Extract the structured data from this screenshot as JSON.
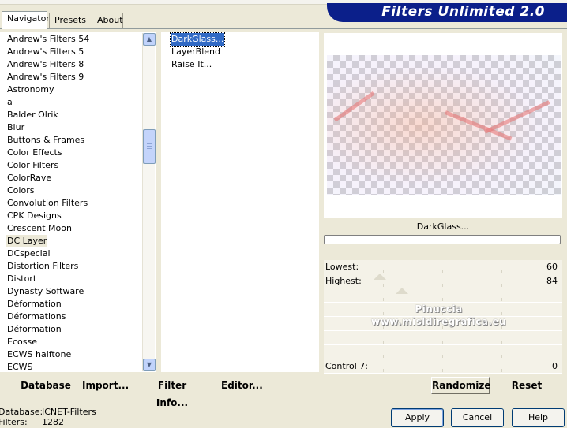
{
  "header": {
    "banner_title": "Filters Unlimited 2.0"
  },
  "tabs": [
    {
      "label": "Navigator",
      "active": true
    },
    {
      "label": "Presets",
      "active": false
    },
    {
      "label": "About",
      "active": false
    }
  ],
  "categories": {
    "items": [
      "Andrew's Filters 54",
      "Andrew's Filters 5",
      "Andrew's Filters 8",
      "Andrew's Filters 9",
      "Astronomy",
      "a",
      "Balder Olrik",
      "Blur",
      "Buttons & Frames",
      "Color Effects",
      "Color Filters",
      "ColorRave",
      "Colors",
      "Convolution Filters",
      "CPK Designs",
      "Crescent Moon",
      "DC Layer",
      "DCspecial",
      "Distortion Filters",
      "Distort",
      "Dynasty Software",
      "Déformation",
      "Déformations",
      "Déformation",
      "Ecosse",
      "ECWS halftone",
      "ECWS"
    ],
    "selected": "DC Layer"
  },
  "filters": {
    "items": [
      "DarkGlass...",
      "LayerBlend",
      "Raise It..."
    ],
    "selected": "DarkGlass..."
  },
  "preview": {
    "filter_name": "DarkGlass...",
    "watermark_line1": "Pinuccia",
    "watermark_line2": "www.misldiregrafica.eu"
  },
  "sliders": [
    {
      "label": "Lowest:",
      "value": "60"
    },
    {
      "label": "Highest:",
      "value": "84"
    },
    {
      "label": "",
      "value": ""
    },
    {
      "label": "",
      "value": ""
    },
    {
      "label": "",
      "value": ""
    },
    {
      "label": "",
      "value": ""
    },
    {
      "label": "",
      "value": ""
    },
    {
      "label": "Control 7:",
      "value": "0"
    }
  ],
  "toolbar": {
    "database": "Database",
    "import": "Import...",
    "filter_info": "Filter Info...",
    "editor": "Editor...",
    "randomize": "Randomize",
    "reset": "Reset"
  },
  "status": {
    "database_label": "Database:",
    "database_value": "ICNET-Filters",
    "filters_label": "Filters:",
    "filters_value": "1282"
  },
  "dialog": {
    "apply": "Apply",
    "cancel": "Cancel",
    "help": "Help"
  }
}
